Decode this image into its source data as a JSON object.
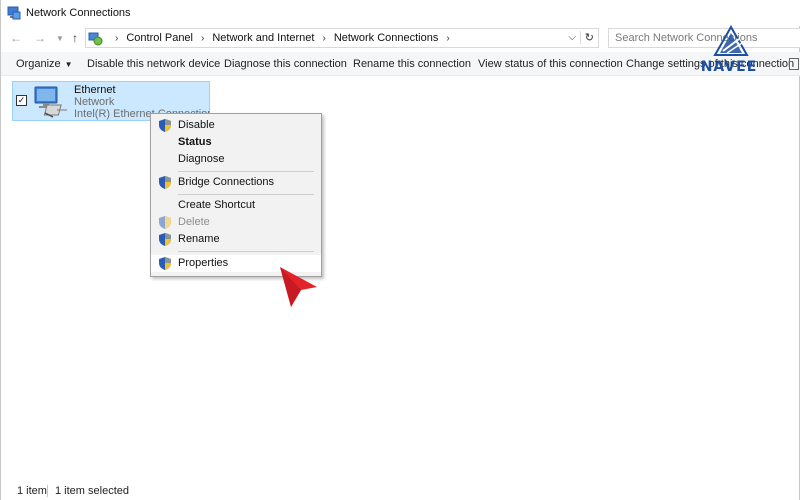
{
  "window": {
    "title": "Network Connections",
    "app_icon": "network-connections-icon"
  },
  "address": {
    "back_icon": "back-arrow-icon",
    "forward_icon": "forward-arrow-icon",
    "recent_icon": "chevron-down-icon",
    "up_icon": "up-arrow-icon",
    "breadcrumbs": [
      "Control Panel",
      "Network and Internet",
      "Network Connections"
    ],
    "search_placeholder": "Search Network Connections"
  },
  "toolbar": {
    "organize": "Organize",
    "commands": [
      "Disable this network device",
      "Diagnose this connection",
      "Rename this connection",
      "View status of this connection",
      "Change settings of this connection"
    ]
  },
  "connection": {
    "name": "Ethernet",
    "status": "Network",
    "device": "Intel(R) Ethernet Connection I",
    "selected": true
  },
  "context_menu": {
    "items": [
      {
        "label": "Disable",
        "shield": true,
        "bold": false,
        "disabled": false
      },
      {
        "label": "Status",
        "shield": false,
        "bold": true,
        "disabled": false
      },
      {
        "label": "Diagnose",
        "shield": false,
        "bold": false,
        "disabled": false
      },
      {
        "label": "Bridge Connections",
        "shield": true,
        "bold": false,
        "disabled": false
      },
      {
        "label": "Create Shortcut",
        "shield": false,
        "bold": false,
        "disabled": false
      },
      {
        "label": "Delete",
        "shield": true,
        "bold": false,
        "disabled": true
      },
      {
        "label": "Rename",
        "shield": true,
        "bold": false,
        "disabled": false
      },
      {
        "label": "Properties",
        "shield": true,
        "bold": false,
        "disabled": false
      }
    ],
    "hovered": "Properties"
  },
  "logo": {
    "text": "NAVEE",
    "color": "#1c4fa0"
  },
  "status_bar": {
    "count": "1 item",
    "selected": "1 item selected"
  },
  "colors": {
    "selection_bg": "#cce8ff",
    "selection_border": "#99d1ff",
    "cursor": "#e3222a"
  }
}
